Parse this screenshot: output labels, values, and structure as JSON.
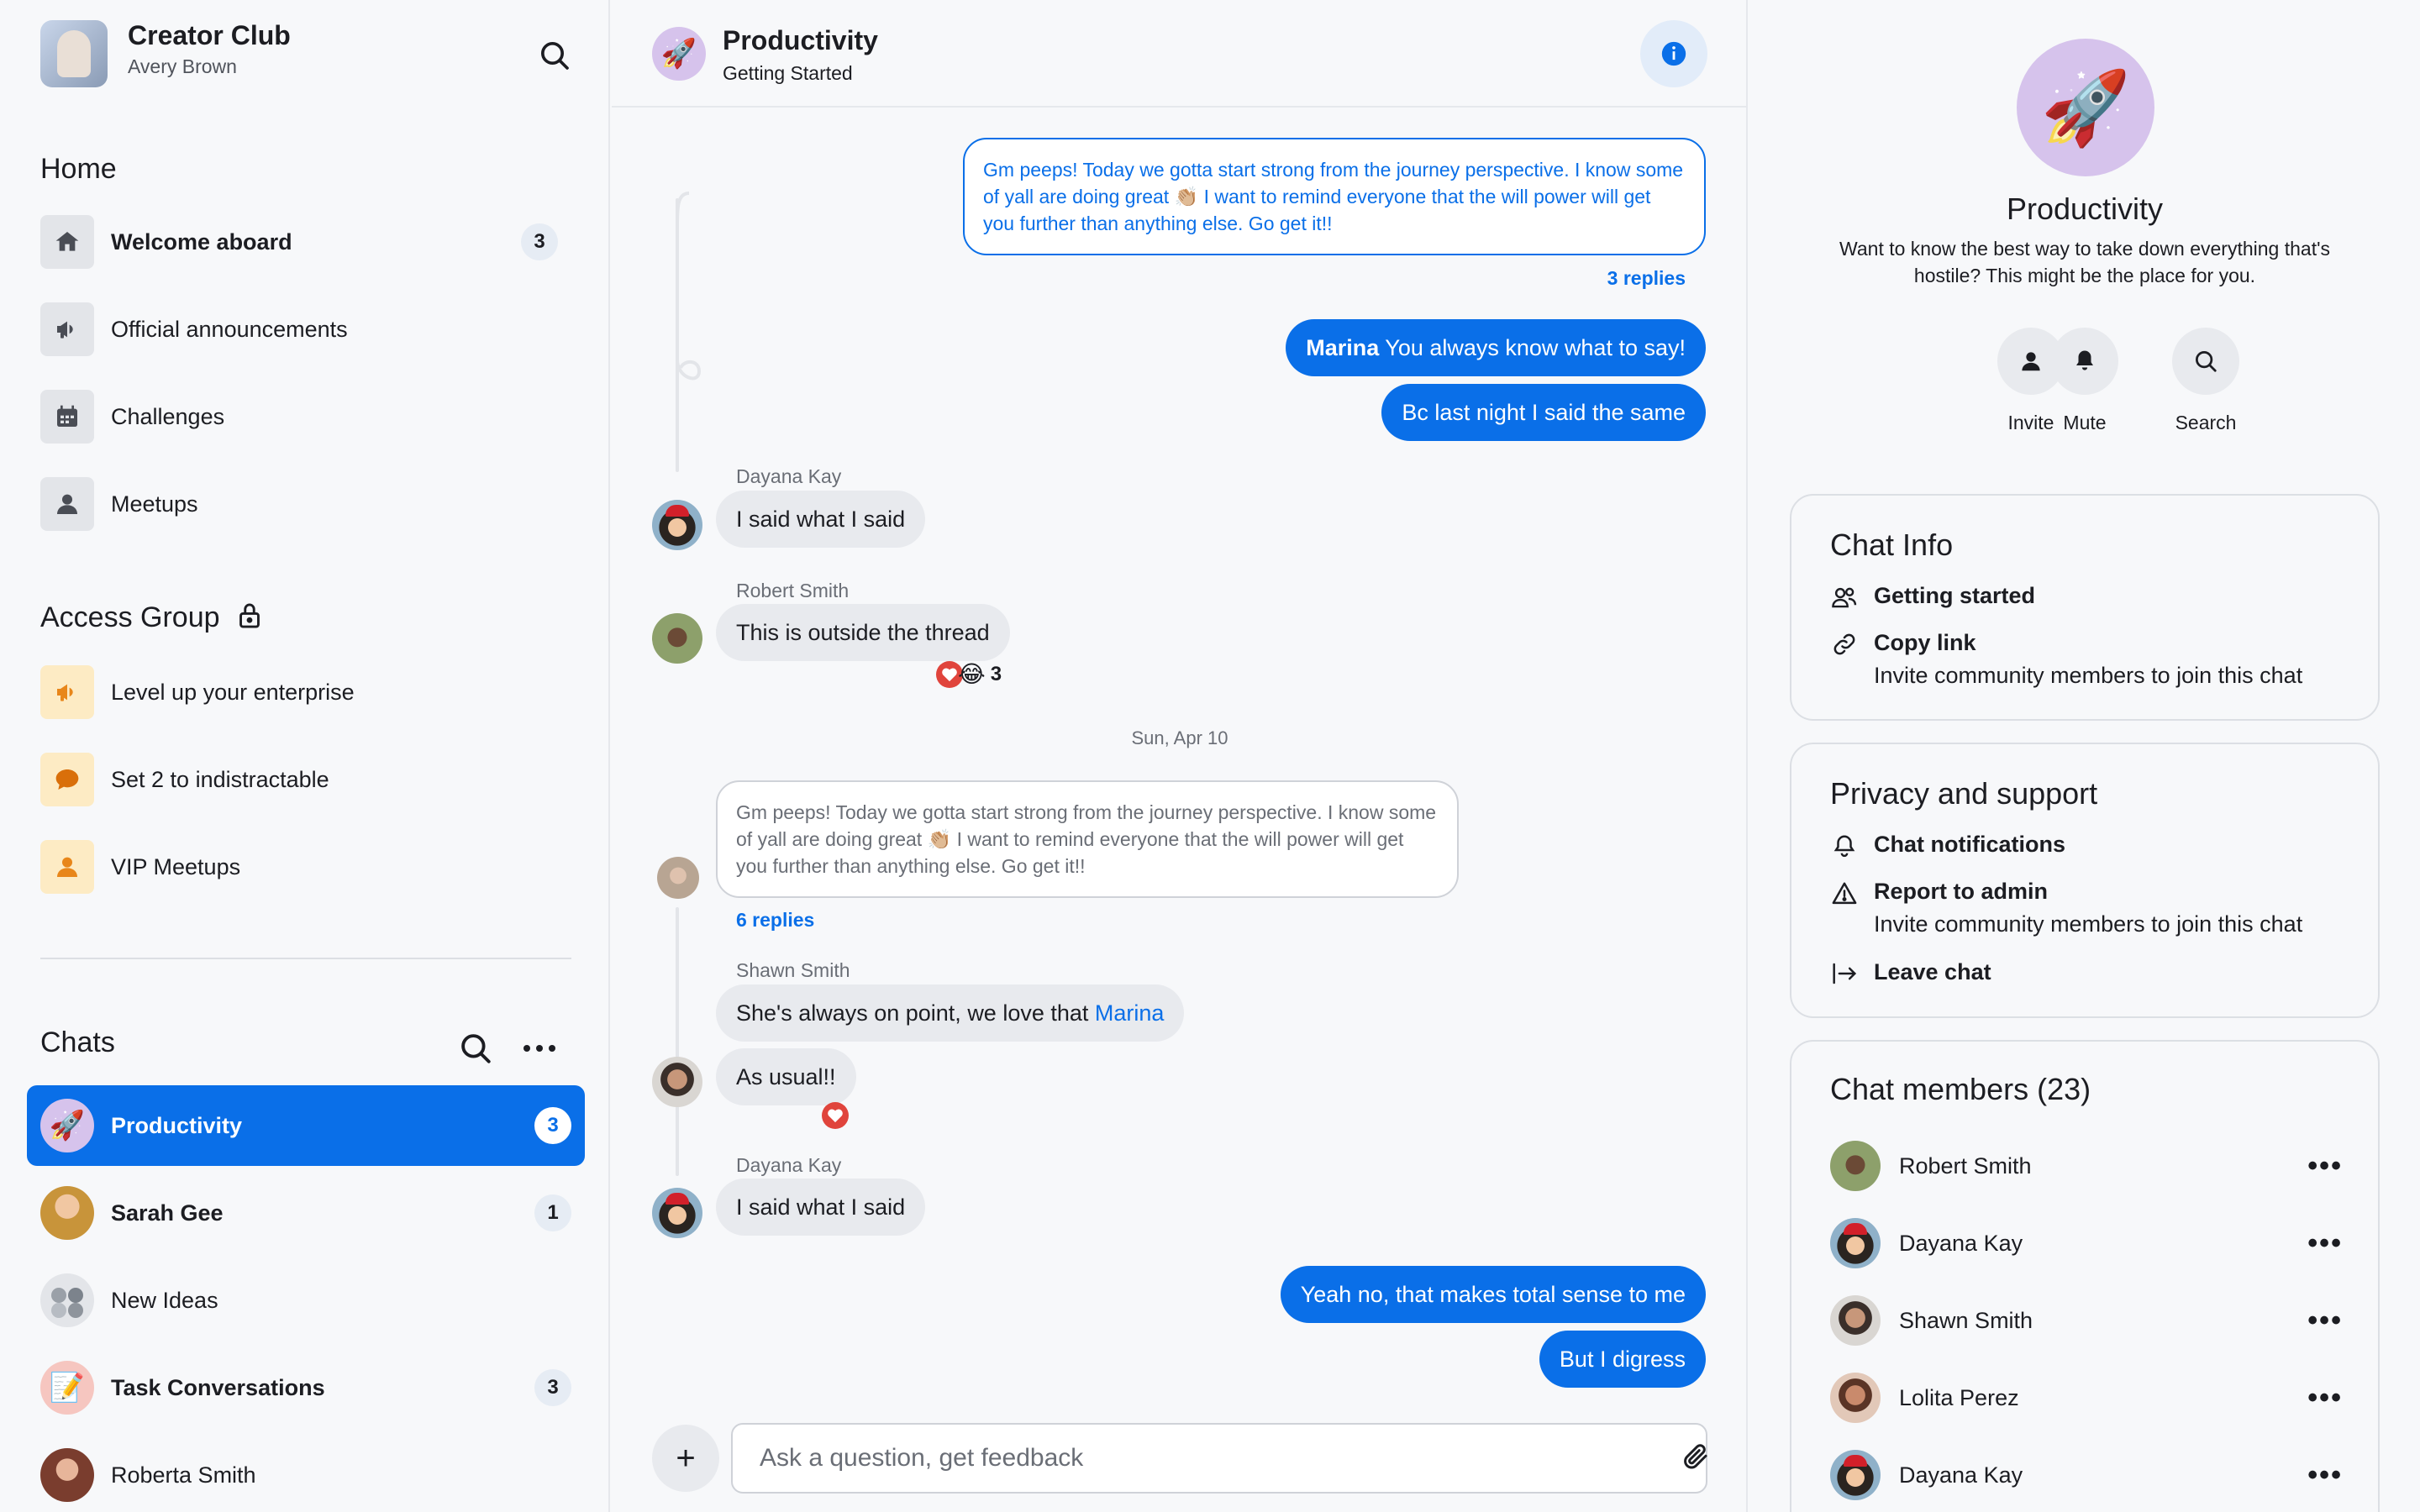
{
  "workspace": {
    "title": "Creator Club",
    "user": "Avery Brown"
  },
  "home": {
    "title": "Home",
    "items": [
      {
        "label": "Welcome aboard",
        "count": "3",
        "bold": true
      },
      {
        "label": "Official announcements"
      },
      {
        "label": "Challenges"
      },
      {
        "label": "Meetups"
      }
    ]
  },
  "access_group": {
    "title": "Access Group",
    "items": [
      {
        "label": "Level up your enterprise"
      },
      {
        "label": "Set 2 to indistractable"
      },
      {
        "label": "VIP Meetups"
      }
    ]
  },
  "chats": {
    "title": "Chats",
    "items": [
      {
        "label": "Productivity",
        "count": "3",
        "active": true
      },
      {
        "label": "Sarah Gee",
        "count": "1"
      },
      {
        "label": "New Ideas"
      },
      {
        "label": "Task Conversations",
        "count": "3"
      },
      {
        "label": "Roberta Smith"
      }
    ]
  },
  "conversation": {
    "title": "Productivity",
    "subtitle": "Getting Started",
    "messages": {
      "quote_out": "Gm peeps! Today we gotta start strong from the journey perspective. I know some of yall are doing great 👏🏼 I want to remind everyone that the will power will get you further than anything else. Go get it!!",
      "quote_out_replies": "3 replies",
      "out1_mention": "Marina",
      "out1_text": " You always know what to say!",
      "out2": "Bc last night I said the same",
      "dayana1_sender": "Dayana Kay",
      "dayana1_text": "I said what I said",
      "robert_sender": "Robert Smith",
      "robert_text": "This is outside the thread",
      "robert_reaction_count": "3",
      "date": "Sun, Apr 10",
      "quote_in": "Gm peeps! Today we gotta start strong from the journey perspective. I know some of yall are doing great 👏🏼 I want to remind everyone that the will power will get you further than anything else. Go get it!!",
      "quote_in_replies": "6 replies",
      "shawn_sender": "Shawn Smith",
      "shawn_text1": "She's always on point, we love that ",
      "shawn_mention": "Marina",
      "shawn_text2": "As usual!!",
      "dayana2_sender": "Dayana Kay",
      "dayana2_text": "I said what I said",
      "out3": "Yeah no, that makes total sense to me",
      "out4": "But I digress"
    },
    "composer_placeholder": "Ask a question, get feedback"
  },
  "details": {
    "title": "Productivity",
    "description": "Want to know the best way to take down everything that's hostile? This might be the place for you.",
    "actions": [
      "Invite",
      "Mute",
      "Search"
    ],
    "chat_info": {
      "title": "Chat Info",
      "getting_started": "Getting started",
      "copy_link": "Copy link",
      "copy_link_sub": "Invite community members to join this chat"
    },
    "privacy": {
      "title": "Privacy and support",
      "notifications": "Chat notifications",
      "report": "Report to admin",
      "report_sub": "Invite community members to join this chat",
      "leave": "Leave chat"
    },
    "members": {
      "title": "Chat members (23)",
      "list": [
        "Robert Smith",
        "Dayana Kay",
        "Shawn Smith",
        "Lolita Perez",
        "Dayana Kay"
      ]
    }
  },
  "colors": {
    "accent": "#0a6fe8",
    "background": "#f7f8fa",
    "reaction_heart": "#e0443c"
  },
  "icons": {
    "header_avatar": "🚀",
    "reactions": [
      "heart",
      "laughing-face"
    ]
  }
}
